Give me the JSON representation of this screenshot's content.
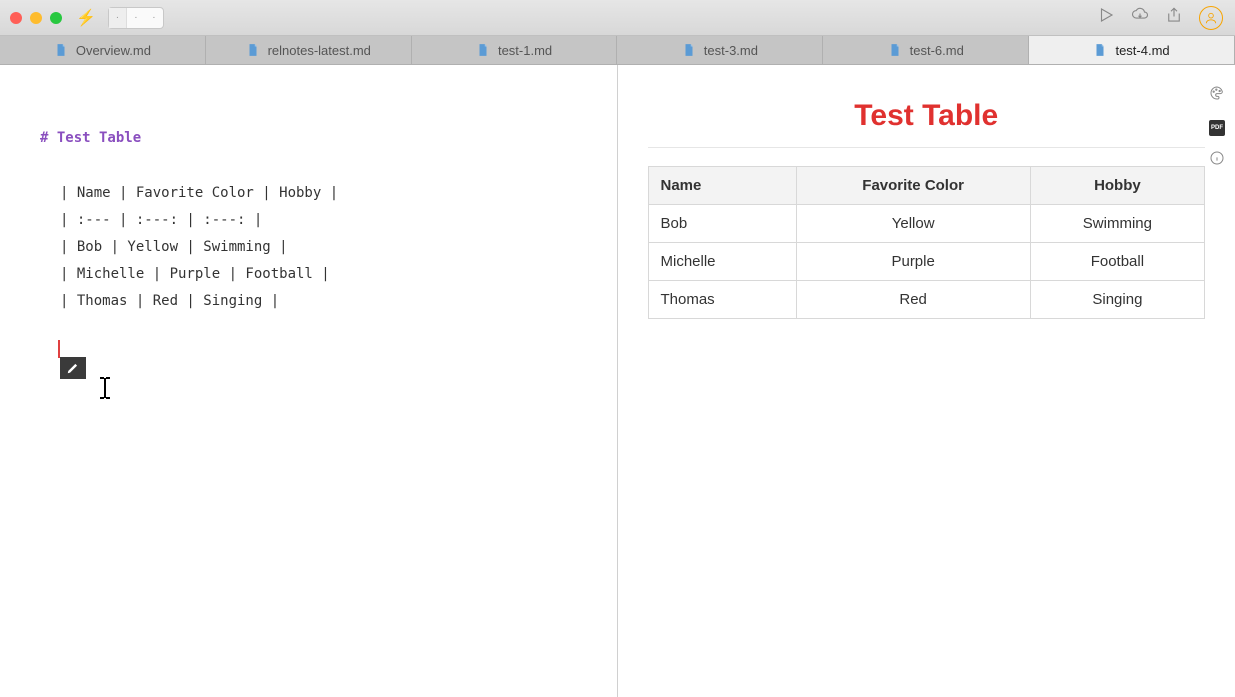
{
  "tabs": [
    {
      "label": "Overview.md",
      "active": false
    },
    {
      "label": "relnotes-latest.md",
      "active": false
    },
    {
      "label": "test-1.md",
      "active": false
    },
    {
      "label": "test-3.md",
      "active": false
    },
    {
      "label": "test-6.md",
      "active": false
    },
    {
      "label": "test-4.md",
      "active": true
    }
  ],
  "editor": {
    "heading": "# Test Table",
    "lines": [
      "| Name | Favorite Color | Hobby |",
      "| :--- | :---: | :---: |",
      "| Bob | Yellow | Swimming |",
      "| Michelle | Purple | Football |",
      "| Thomas | Red | Singing |"
    ]
  },
  "preview": {
    "title": "Test Table",
    "table": {
      "headers": [
        "Name",
        "Favorite Color",
        "Hobby"
      ],
      "align": [
        "l",
        "c",
        "c"
      ],
      "rows": [
        [
          "Bob",
          "Yellow",
          "Swimming"
        ],
        [
          "Michelle",
          "Purple",
          "Football"
        ],
        [
          "Thomas",
          "Red",
          "Singing"
        ]
      ]
    },
    "pdf_label": "PDF"
  }
}
